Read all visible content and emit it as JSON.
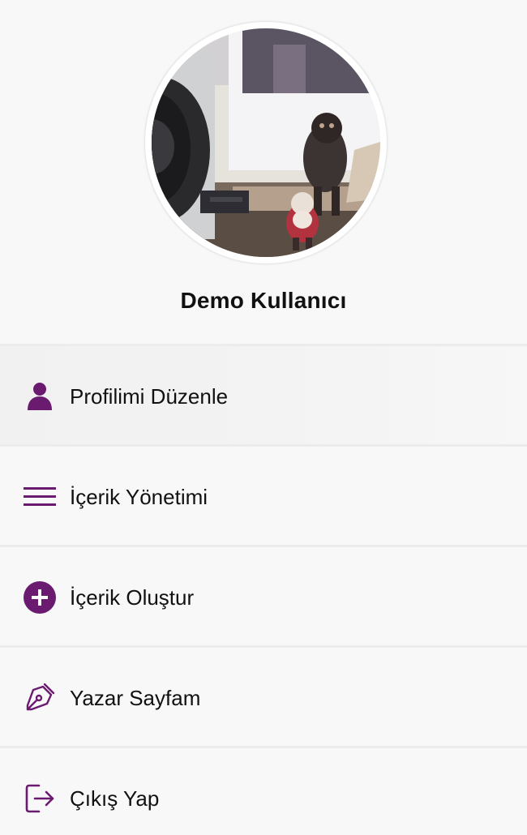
{
  "user": {
    "name": "Demo Kullanıcı"
  },
  "menu": {
    "items": [
      {
        "label": "Profilimi Düzenle",
        "icon": "person-icon",
        "active": true
      },
      {
        "label": "İçerik Yönetimi",
        "icon": "hamburger-menu-icon",
        "active": false
      },
      {
        "label": "İçerik Oluştur",
        "icon": "plus-circle-icon",
        "active": false
      },
      {
        "label": "Yazar Sayfam",
        "icon": "pen-nib-icon",
        "active": false
      },
      {
        "label": "Çıkış Yap",
        "icon": "logout-icon",
        "active": false
      }
    ]
  },
  "colors": {
    "accent": "#6a1b6f",
    "background": "#f8f8f8",
    "divider": "#ececec",
    "text": "#111111"
  }
}
